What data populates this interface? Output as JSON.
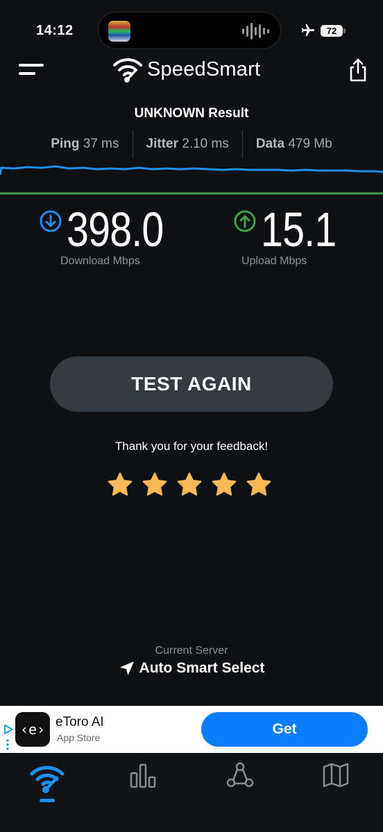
{
  "status_bar": {
    "time": "14:12",
    "battery": "72"
  },
  "header": {
    "brand": "SpeedSmart"
  },
  "result": {
    "title": "UNKNOWN Result",
    "ping_label": "Ping",
    "ping_value": "37 ms",
    "jitter_label": "Jitter",
    "jitter_value": "2.10 ms",
    "data_label": "Data",
    "data_value": "479 Mb"
  },
  "speeds": {
    "download_value": "398.0",
    "download_label": "Download Mbps",
    "upload_value": "15.1",
    "upload_label": "Upload Mbps"
  },
  "actions": {
    "test_again": "TEST AGAIN"
  },
  "feedback": {
    "text": "Thank you for your feedback!",
    "rating": 5,
    "max": 5
  },
  "server": {
    "label": "Current Server",
    "name": "Auto Smart Select"
  },
  "ad": {
    "app_icon_text": "‹e›",
    "app_name": "eToro AI",
    "store": "App Store",
    "cta": "Get"
  },
  "colors": {
    "download": "#1d8ff0",
    "upload": "#43a047",
    "star": "#f7b955",
    "background": "#0f1013",
    "button": "#353b42",
    "ad_cta": "#0a7dfb"
  },
  "icons": [
    "menu-icon",
    "wifi-logo-icon",
    "share-icon",
    "airplane-icon",
    "download-arrow-icon",
    "upload-arrow-icon",
    "star-icon",
    "location-arrow-icon",
    "adchoices-icon",
    "tab-speed-icon",
    "tab-results-icon",
    "tab-network-icon",
    "tab-map-icon"
  ]
}
